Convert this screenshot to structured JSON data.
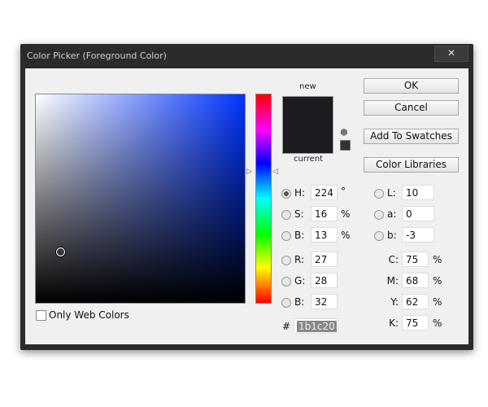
{
  "window": {
    "title": "Color Picker (Foreground Color)",
    "close": "✕"
  },
  "preview": {
    "new_label": "new",
    "current_label": "current",
    "color": "#1b1c20"
  },
  "buttons": {
    "ok": "OK",
    "cancel": "Cancel",
    "add": "Add To Swatches",
    "libraries": "Color Libraries"
  },
  "hsb": [
    {
      "label": "H:",
      "value": "224",
      "unit": "°",
      "selected": true
    },
    {
      "label": "S:",
      "value": "16",
      "unit": "%"
    },
    {
      "label": "B:",
      "value": "13",
      "unit": "%"
    }
  ],
  "rgb": [
    {
      "label": "R:",
      "value": "27"
    },
    {
      "label": "G:",
      "value": "28"
    },
    {
      "label": "B:",
      "value": "32"
    }
  ],
  "lab": [
    {
      "label": "L:",
      "value": "10"
    },
    {
      "label": "a:",
      "value": "0"
    },
    {
      "label": "b:",
      "value": "-3"
    }
  ],
  "cmyk": [
    {
      "label": "C:",
      "value": "75",
      "unit": "%"
    },
    {
      "label": "M:",
      "value": "68",
      "unit": "%"
    },
    {
      "label": "Y:",
      "value": "62",
      "unit": "%"
    },
    {
      "label": "K:",
      "value": "75",
      "unit": "%"
    }
  ],
  "hex": {
    "label": "#",
    "value": "1b1c20"
  },
  "web_colors": {
    "label": "Only Web Colors",
    "checked": false
  }
}
